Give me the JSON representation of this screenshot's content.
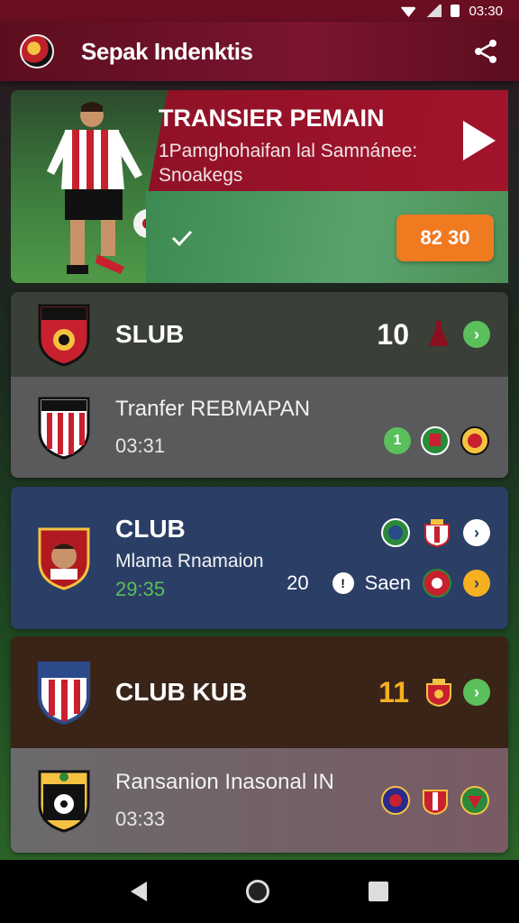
{
  "status_bar": {
    "time": "03:30"
  },
  "app_bar": {
    "title": "Sepak Indenktis"
  },
  "hero": {
    "title": "TRANSIER PEMAIN",
    "subtitle": "1Pamghohaifan lal Samnánee: Snoakegs",
    "badge": "82 30"
  },
  "cards": [
    {
      "club_name": "SLUB",
      "score": "10",
      "row_label": "Tranfer REBMAPAN",
      "row_time": "03:31",
      "row_count": "1"
    },
    {
      "club_name": "CLUB",
      "row_label": "Mlama Rnamaion",
      "row_time": "29:35",
      "score": "20",
      "extra_label": "Saen"
    },
    {
      "club_name": "CLUB KUB",
      "score": "11",
      "row_label": "Ransanion Inasonal IN",
      "row_time": "03:33"
    }
  ],
  "colors": {
    "app_bar": "#7a1530",
    "hero_banner": "#a3142c",
    "badge_orange": "#f07a20",
    "accent_green": "#5bbf5b",
    "accent_yellow": "#f5b020"
  }
}
